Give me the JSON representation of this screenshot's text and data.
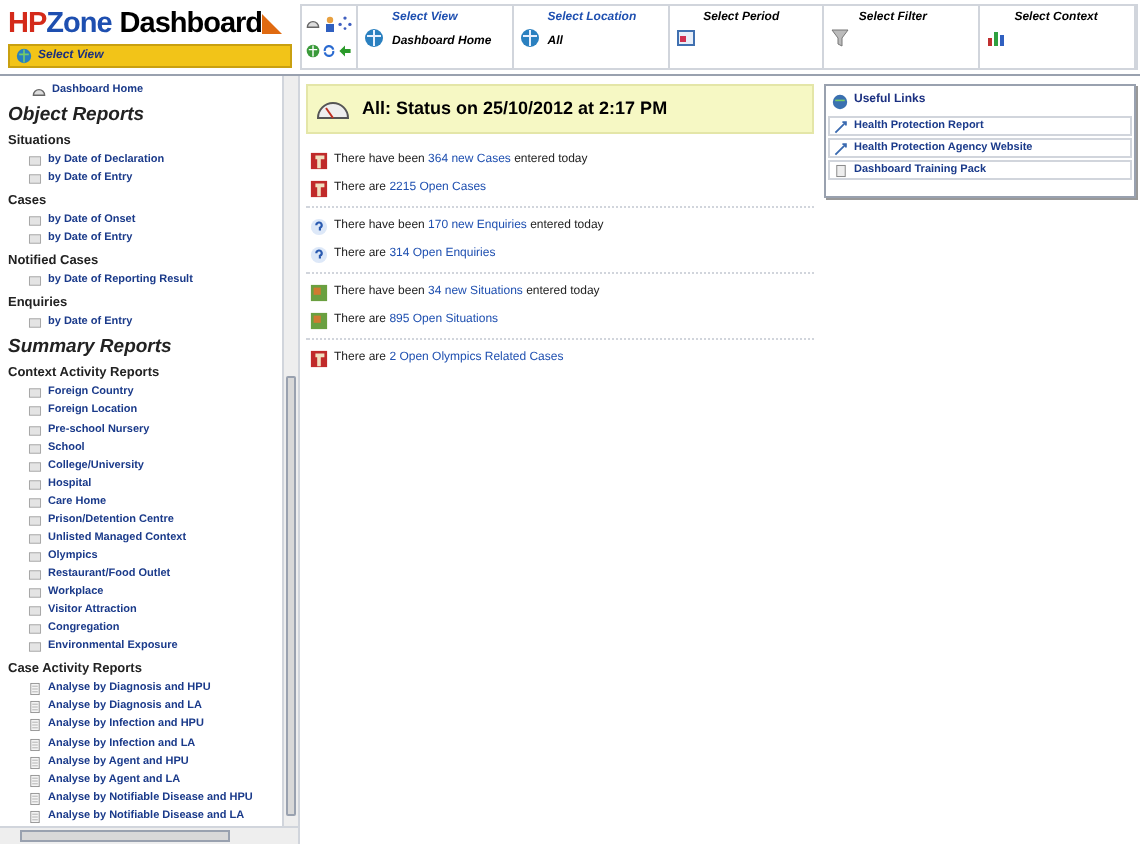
{
  "logo": [
    "HP",
    "Zone",
    "Dashboard"
  ],
  "select_view_button": "Select View",
  "toolbar": {
    "selectors": [
      {
        "label": "Select View",
        "value": "Dashboard Home",
        "kind": "globe"
      },
      {
        "label": "Select Location",
        "value": "All",
        "kind": "globe"
      },
      {
        "label": "Select Period",
        "kind": "calendar"
      },
      {
        "label": "Select Filter",
        "kind": "filter"
      },
      {
        "label": "Select Context",
        "kind": "chart"
      }
    ]
  },
  "sidebar": {
    "home": "Dashboard Home",
    "sections": [
      {
        "title": "Object Reports",
        "groups": [
          {
            "title": "Situations",
            "kind": "page",
            "items": [
              "by Date of Declaration",
              "by Date of Entry"
            ]
          },
          {
            "title": "Cases",
            "kind": "page",
            "items": [
              "by Date of Onset",
              "by Date of Entry"
            ]
          },
          {
            "title": "Notified Cases",
            "kind": "page",
            "items": [
              "by Date of Reporting Result"
            ]
          },
          {
            "title": "Enquiries",
            "kind": "page",
            "items": [
              "by Date of Entry"
            ]
          }
        ]
      },
      {
        "title": "Summary Reports",
        "groups": [
          {
            "title": "Context Activity Reports",
            "kind": "page",
            "items": [
              "Foreign Country",
              "Foreign Location",
              "Pre-school Nursery",
              "School",
              "College/University",
              "Hospital",
              "Care Home",
              "Prison/Detention Centre",
              "Unlisted Managed Context",
              "Olympics",
              "Restaurant/Food Outlet",
              "Workplace",
              "Visitor Attraction",
              "Congregation",
              "Environmental Exposure"
            ]
          },
          {
            "title": "Case Activity Reports",
            "kind": "sheet",
            "items": [
              "Analyse by Diagnosis and HPU",
              "Analyse by Diagnosis and LA",
              "Analyse by Infection and HPU",
              "Analyse by Infection and LA",
              "Analyse by Agent and HPU",
              "Analyse by Agent and LA",
              "Analyse by Notifiable Disease and HPU",
              "Analyse by Notifiable Disease and LA"
            ]
          }
        ]
      }
    ]
  },
  "status": {
    "title": "All: Status on 25/10/2012 at 2:17 PM"
  },
  "blocks": [
    [
      {
        "kind": "cases",
        "before": "There have been ",
        "link": "364 new Cases",
        "after": " entered today"
      },
      {
        "kind": "cases",
        "before": "There are ",
        "link": "2215 Open Cases"
      }
    ],
    [
      {
        "kind": "enquiries",
        "before": "There have been ",
        "link": "170 new Enquiries",
        "after": " entered today"
      },
      {
        "kind": "enquiries",
        "before": "There are ",
        "link": "314 Open Enquiries"
      }
    ],
    [
      {
        "kind": "situations",
        "before": "There have been ",
        "link": "34 new Situations",
        "after": " entered today"
      },
      {
        "kind": "situations",
        "before": "There are ",
        "link": "895 Open Situations"
      }
    ],
    [
      {
        "kind": "cases",
        "before": "There are ",
        "link": "2 Open Olympics Related Cases"
      }
    ]
  ],
  "useful_links": {
    "title": "Useful Links",
    "links": [
      {
        "kind": "web",
        "label": "Health Protection Report"
      },
      {
        "kind": "web",
        "label": "Health Protection Agency Website"
      },
      {
        "kind": "doc",
        "label": "Dashboard Training Pack"
      }
    ]
  }
}
